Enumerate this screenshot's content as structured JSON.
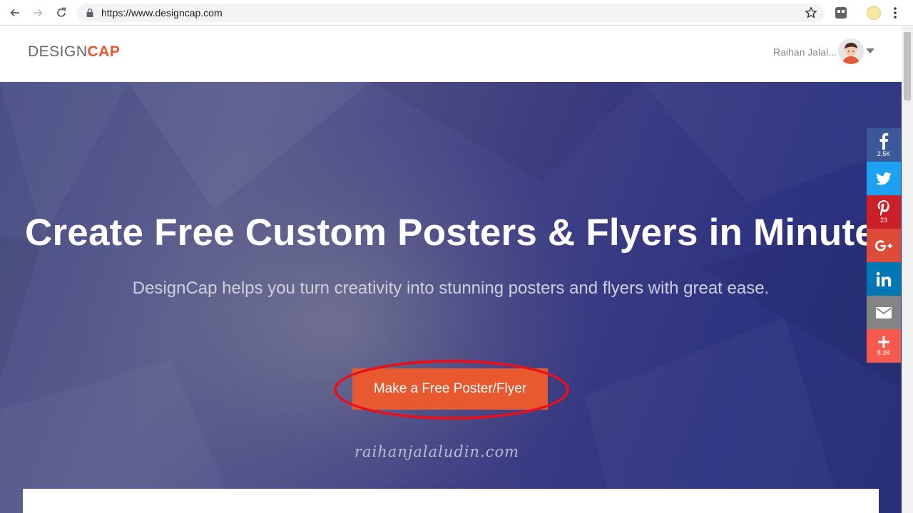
{
  "browser": {
    "url": "https://www.designcap.com"
  },
  "header": {
    "logo_part1": "DESIGN",
    "logo_part2": "CAP",
    "user_name": "Raihan Jalal..."
  },
  "hero": {
    "title": "Create Free Custom Posters & Flyers in Minutes",
    "subtitle": "DesignCap helps you turn creativity into stunning posters and flyers with great ease.",
    "cta_label": "Make a Free Poster/Flyer",
    "watermark": "raihanjalaludin.com"
  },
  "share": {
    "facebook_count": "2.5K",
    "pinterest_count": "23",
    "more_count": "8.3K",
    "colors": {
      "facebook": "#3b5998",
      "twitter": "#1da1f2",
      "pinterest": "#cb2027",
      "googleplus": "#dd4b39",
      "linkedin": "#0077b5",
      "email": "#848484",
      "more": "#f65a4c"
    }
  },
  "colors": {
    "accent": "#e8592f",
    "highlight_ring": "#e8101a"
  }
}
